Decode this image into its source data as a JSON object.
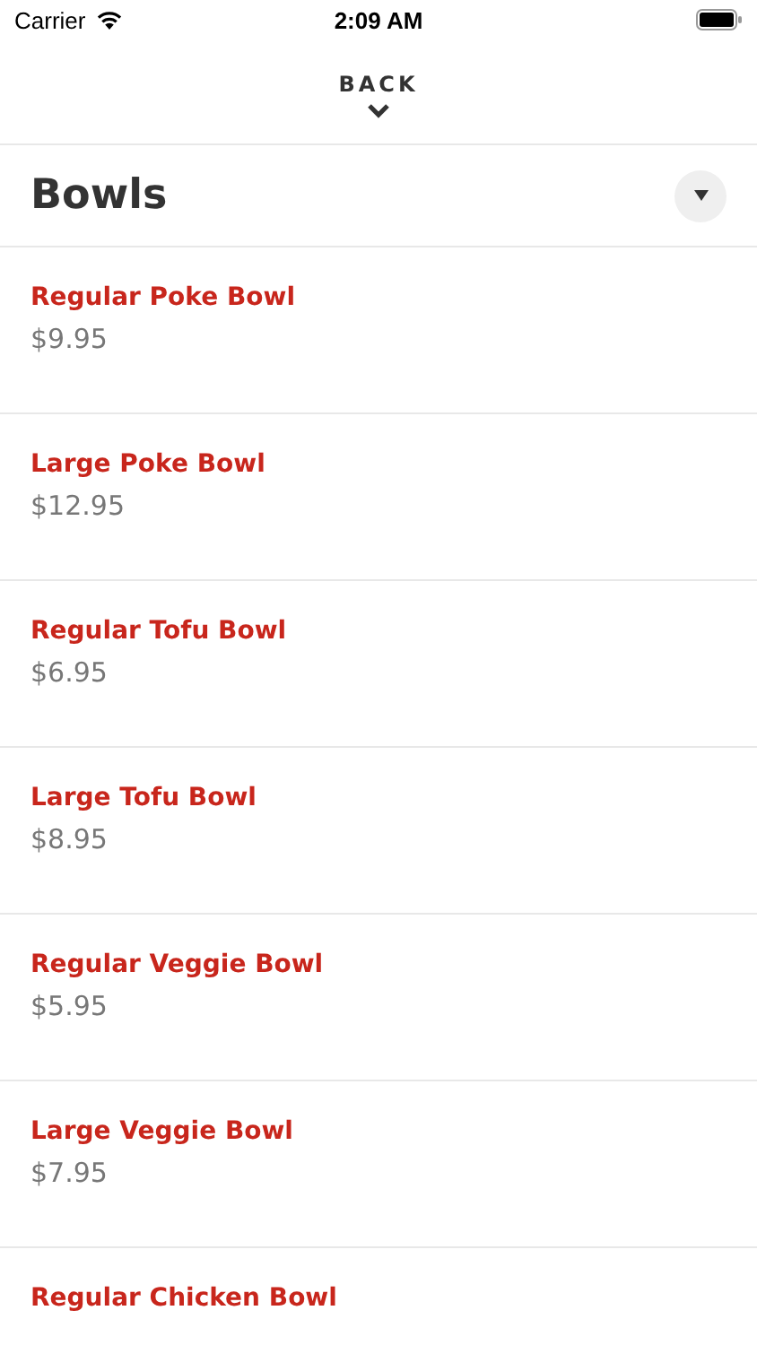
{
  "status_bar": {
    "carrier": "Carrier",
    "time": "2:09 AM"
  },
  "back": {
    "label": "BACK"
  },
  "section": {
    "title": "Bowls"
  },
  "items": [
    {
      "name": "Regular Poke Bowl",
      "price": "$9.95"
    },
    {
      "name": "Large Poke Bowl",
      "price": "$12.95"
    },
    {
      "name": "Regular Tofu Bowl",
      "price": "$6.95"
    },
    {
      "name": "Large Tofu Bowl",
      "price": "$8.95"
    },
    {
      "name": "Regular Veggie Bowl",
      "price": "$5.95"
    },
    {
      "name": "Large Veggie Bowl",
      "price": "$7.95"
    },
    {
      "name": "Regular Chicken Bowl"
    }
  ]
}
